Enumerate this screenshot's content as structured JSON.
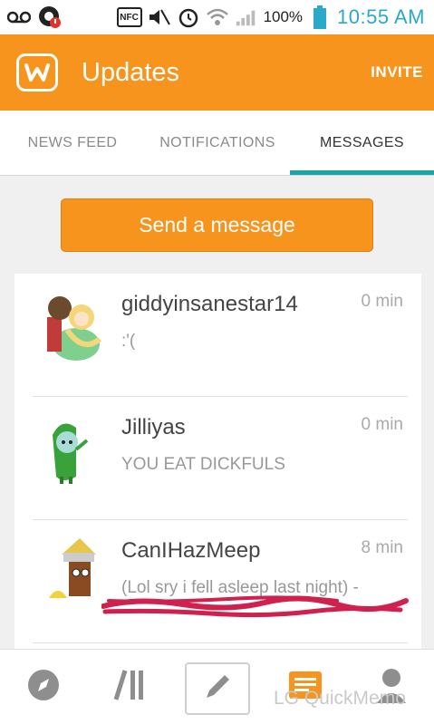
{
  "status_bar": {
    "icons": [
      "voicemail-icon",
      "notification-alert-icon",
      "nfc-icon",
      "volume-muted-icon",
      "alarm-icon",
      "wifi-icon",
      "signal-icon",
      "battery-icon"
    ],
    "nfc_label": "NFC",
    "battery": "100%",
    "time": "10:55 AM"
  },
  "app_bar": {
    "logo_letter": "w",
    "title": "Updates",
    "invite_label": "INVITE"
  },
  "tabs": [
    {
      "label": "NEWS FEED",
      "active": false
    },
    {
      "label": "NOTIFICATIONS",
      "active": false
    },
    {
      "label": "MESSAGES",
      "active": true
    }
  ],
  "send_button_label": "Send a message",
  "messages": [
    {
      "name": "giddyinsanestar14",
      "time": "0  min",
      "preview": ":'("
    },
    {
      "name": "Jilliyas",
      "time": "0  min",
      "preview": "YOU EAT DICKFULS"
    },
    {
      "name": "CanIHazMeep",
      "time": "8  min",
      "preview": "(Lol sry i fell asleep last night)  -"
    }
  ],
  "bottom_nav": {
    "items": [
      "compass-icon",
      "library-icon",
      "pencil-icon",
      "inbox-icon",
      "profile-icon"
    ],
    "watermark": "LG QuickMemo"
  },
  "colors": {
    "brand_orange": "#f7941d",
    "tab_accent": "#1aa6a9",
    "time_blue": "#2aa9c8",
    "scribble": "#d0204e"
  }
}
